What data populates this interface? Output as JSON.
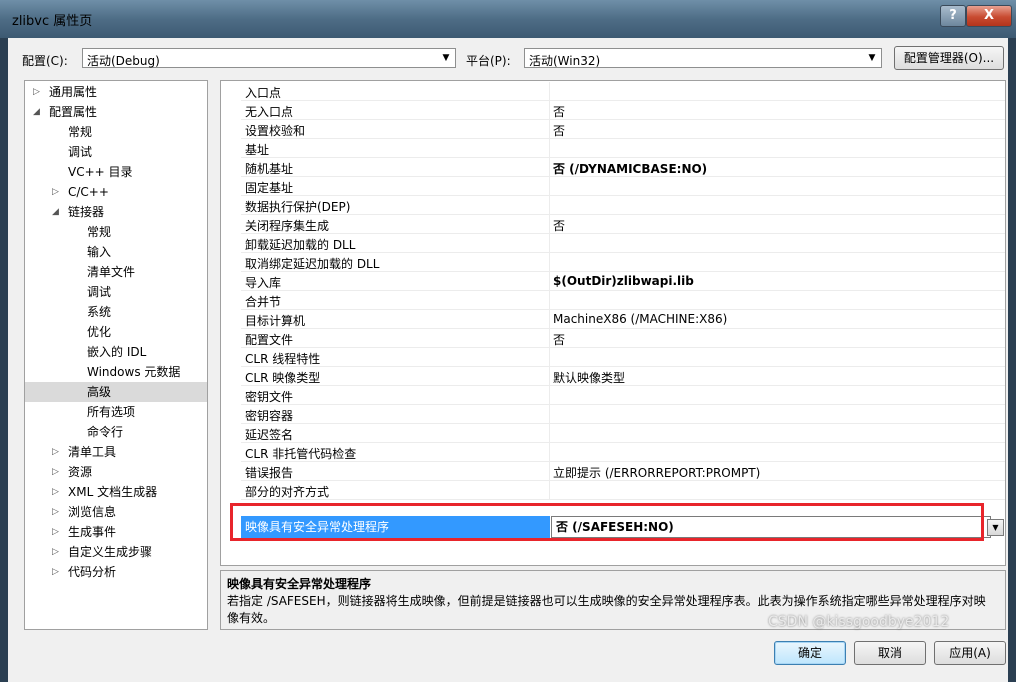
{
  "window": {
    "title": "zlibvc 属性页",
    "help_label": "?",
    "close_label": "X"
  },
  "toolbar": {
    "config_label": "配置(C):",
    "config_value": "活动(Debug)",
    "platform_label": "平台(P):",
    "platform_value": "活动(Win32)",
    "config_manager_label": "配置管理器(O)..."
  },
  "tree": [
    {
      "label": "通用属性",
      "level": 0,
      "twisty": "▷"
    },
    {
      "label": "配置属性",
      "level": 0,
      "twisty": "◢"
    },
    {
      "label": "常规",
      "level": 1,
      "twisty": ""
    },
    {
      "label": "调试",
      "level": 1,
      "twisty": ""
    },
    {
      "label": "VC++ 目录",
      "level": 1,
      "twisty": ""
    },
    {
      "label": "C/C++",
      "level": 1,
      "twisty": "▷"
    },
    {
      "label": "链接器",
      "level": 1,
      "twisty": "◢"
    },
    {
      "label": "常规",
      "level": 2,
      "twisty": ""
    },
    {
      "label": "输入",
      "level": 2,
      "twisty": ""
    },
    {
      "label": "清单文件",
      "level": 2,
      "twisty": ""
    },
    {
      "label": "调试",
      "level": 2,
      "twisty": ""
    },
    {
      "label": "系统",
      "level": 2,
      "twisty": ""
    },
    {
      "label": "优化",
      "level": 2,
      "twisty": ""
    },
    {
      "label": "嵌入的 IDL",
      "level": 2,
      "twisty": ""
    },
    {
      "label": "Windows 元数据",
      "level": 2,
      "twisty": ""
    },
    {
      "label": "高级",
      "level": 2,
      "twisty": "",
      "selected": true
    },
    {
      "label": "所有选项",
      "level": 2,
      "twisty": ""
    },
    {
      "label": "命令行",
      "level": 2,
      "twisty": ""
    },
    {
      "label": "清单工具",
      "level": 1,
      "twisty": "▷"
    },
    {
      "label": "资源",
      "level": 1,
      "twisty": "▷"
    },
    {
      "label": "XML 文档生成器",
      "level": 1,
      "twisty": "▷"
    },
    {
      "label": "浏览信息",
      "level": 1,
      "twisty": "▷"
    },
    {
      "label": "生成事件",
      "level": 1,
      "twisty": "▷"
    },
    {
      "label": "自定义生成步骤",
      "level": 1,
      "twisty": "▷"
    },
    {
      "label": "代码分析",
      "level": 1,
      "twisty": "▷"
    }
  ],
  "properties": [
    {
      "name": "入口点",
      "value": ""
    },
    {
      "name": "无入口点",
      "value": "否"
    },
    {
      "name": "设置校验和",
      "value": "否"
    },
    {
      "name": "基址",
      "value": ""
    },
    {
      "name": "随机基址",
      "value": "否 (/DYNAMICBASE:NO)",
      "bold": true
    },
    {
      "name": "固定基址",
      "value": ""
    },
    {
      "name": "数据执行保护(DEP)",
      "value": ""
    },
    {
      "name": "关闭程序集生成",
      "value": "否"
    },
    {
      "name": "卸载延迟加载的 DLL",
      "value": ""
    },
    {
      "name": "取消绑定延迟加载的 DLL",
      "value": ""
    },
    {
      "name": "导入库",
      "value": "$(OutDir)zlibwapi.lib",
      "bold": true
    },
    {
      "name": "合并节",
      "value": ""
    },
    {
      "name": "目标计算机",
      "value": "MachineX86 (/MACHINE:X86)"
    },
    {
      "name": "配置文件",
      "value": "否"
    },
    {
      "name": "CLR 线程特性",
      "value": ""
    },
    {
      "name": "CLR 映像类型",
      "value": "默认映像类型"
    },
    {
      "name": "密钥文件",
      "value": ""
    },
    {
      "name": "密钥容器",
      "value": ""
    },
    {
      "name": "延迟签名",
      "value": ""
    },
    {
      "name": "CLR 非托管代码检查",
      "value": ""
    },
    {
      "name": "错误报告",
      "value": "立即提示 (/ERRORREPORT:PROMPT)"
    },
    {
      "name": "部分的对齐方式",
      "value": ""
    }
  ],
  "selected_property": {
    "name": "映像具有安全异常处理程序",
    "value": "否 (/SAFESEH:NO)"
  },
  "description": {
    "title": "映像具有安全异常处理程序",
    "body": "若指定 /SAFESEH，则链接器将生成映像，但前提是链接器也可以生成映像的安全异常处理程序表。此表为操作系统指定哪些异常处理程序对映像有效。"
  },
  "buttons": {
    "ok": "确定",
    "cancel": "取消",
    "apply": "应用(A)"
  },
  "watermark": "CSDN @kissgoodbye2012",
  "colors": {
    "selection": "#3399ff",
    "highlight_box": "#e8252b",
    "tree_selected": "#dadada"
  }
}
